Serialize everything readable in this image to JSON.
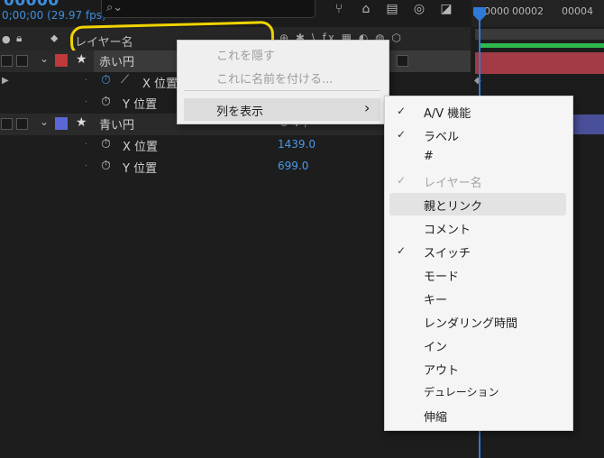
{
  "header": {
    "timecode": "00000",
    "fps": "0;00;00 (29.97 fps)"
  },
  "timeline": {
    "ruler_labels": [
      "00000",
      "00002",
      "00004"
    ]
  },
  "columns": {
    "layer_name": "レイヤー名",
    "icons": "⊕ ✱ \\ fx ▦ ◐ ◍ ⬡"
  },
  "layers": [
    {
      "name": "赤い円",
      "color": "#c0393b",
      "x_label": "X 位置",
      "y_label": "Y 位置"
    },
    {
      "name": "青い円",
      "color": "#5b67d4",
      "x_label": "X 位置",
      "x_value": "1439.0",
      "y_label": "Y 位置",
      "y_value": "699.0"
    }
  ],
  "context_menu": {
    "items": [
      {
        "label": "これを隠す",
        "enabled": false
      },
      {
        "label": "これに名前を付ける...",
        "enabled": false
      },
      {
        "label": "列を表示",
        "enabled": true,
        "submenu_arrow": "›"
      }
    ]
  },
  "submenu": {
    "items": [
      {
        "label": "A/V 機能",
        "checked": true,
        "enabled": true
      },
      {
        "label": "ラベル",
        "checked": true,
        "enabled": true
      },
      {
        "label": "#",
        "checked": false,
        "enabled": true
      },
      {
        "label": "レイヤー名",
        "checked": true,
        "enabled": false
      },
      {
        "label": "親とリンク",
        "checked": false,
        "enabled": true,
        "highlighted": true
      },
      {
        "label": "コメント",
        "checked": false,
        "enabled": true
      },
      {
        "label": "スイッチ",
        "checked": true,
        "enabled": true
      },
      {
        "label": "モード",
        "checked": false,
        "enabled": true
      },
      {
        "label": "キー",
        "checked": false,
        "enabled": true
      },
      {
        "label": "レンダリング時間",
        "checked": false,
        "enabled": true
      },
      {
        "label": "イン",
        "checked": false,
        "enabled": true
      },
      {
        "label": "アウト",
        "checked": false,
        "enabled": true
      },
      {
        "label": "デュレーション",
        "checked": false,
        "enabled": true
      },
      {
        "label": "伸縮",
        "checked": false,
        "enabled": true
      }
    ],
    "check_glyph": "✓"
  }
}
